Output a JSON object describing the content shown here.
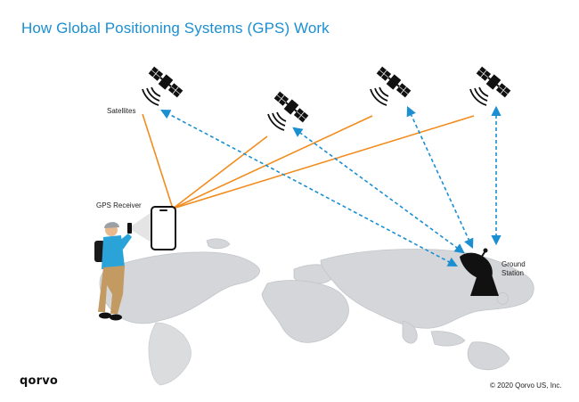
{
  "title": "How Global Positioning Systems (GPS) Work",
  "labels": {
    "satellites": "Satellites",
    "gps_receiver": "GPS Receiver",
    "ground_line1": "Ground",
    "ground_line2": "Station"
  },
  "footer": {
    "logo": "qorvo",
    "copyright": "© 2020 Qorvo US, Inc."
  },
  "colors": {
    "title": "#1b8fd2",
    "signal_line": "#f28c1e",
    "link_line": "#1b8fd2",
    "map": "#d4d6d9",
    "map_edge": "#c2c5c9"
  },
  "icons": [
    "satellite-icon",
    "signal-waves-icon",
    "smartphone-icon",
    "ground-station-dish-icon",
    "person-icon"
  ]
}
